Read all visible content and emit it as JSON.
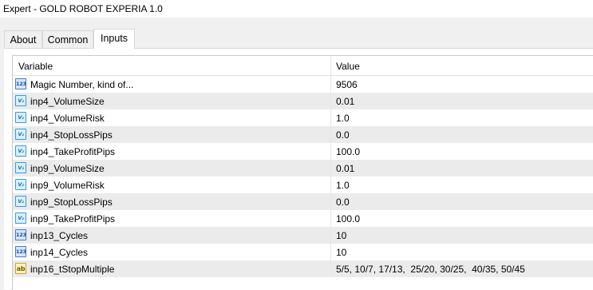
{
  "window": {
    "title": "Expert - GOLD ROBOT EXPERIA 1.0"
  },
  "tabs": [
    {
      "label": "About",
      "active": false
    },
    {
      "label": "Common",
      "active": false
    },
    {
      "label": "Inputs",
      "active": true
    }
  ],
  "table": {
    "columns": [
      "Variable",
      "Value"
    ],
    "rows": [
      {
        "icon": "integer-type-icon",
        "icon_text": "123",
        "name": "Magic Number, kind of...",
        "value": "9506"
      },
      {
        "icon": "double-type-icon",
        "icon_text": "V₂",
        "name": "inp4_VolumeSize",
        "value": "0.01"
      },
      {
        "icon": "double-type-icon",
        "icon_text": "V₂",
        "name": "inp4_VolumeRisk",
        "value": "1.0"
      },
      {
        "icon": "double-type-icon",
        "icon_text": "V₂",
        "name": "inp4_StopLossPips",
        "value": "0.0"
      },
      {
        "icon": "double-type-icon",
        "icon_text": "V₂",
        "name": "inp4_TakeProfitPips",
        "value": "100.0"
      },
      {
        "icon": "double-type-icon",
        "icon_text": "V₂",
        "name": "inp9_VolumeSize",
        "value": "0.01"
      },
      {
        "icon": "double-type-icon",
        "icon_text": "V₂",
        "name": "inp9_VolumeRisk",
        "value": "1.0"
      },
      {
        "icon": "double-type-icon",
        "icon_text": "V₂",
        "name": "inp9_StopLossPips",
        "value": "0.0"
      },
      {
        "icon": "double-type-icon",
        "icon_text": "V₂",
        "name": "inp9_TakeProfitPips",
        "value": "100.0"
      },
      {
        "icon": "integer-type-icon",
        "icon_text": "123",
        "name": "inp13_Cycles",
        "value": "10"
      },
      {
        "icon": "integer-type-icon",
        "icon_text": "123",
        "name": "inp14_Cycles",
        "value": "10"
      },
      {
        "icon": "string-type-icon",
        "icon_text": "ab",
        "name": "inp16_tStopMultiple",
        "value": "5/5, 10/7, 17/13,  25/20, 30/25,  40/35, 50/45"
      }
    ]
  }
}
